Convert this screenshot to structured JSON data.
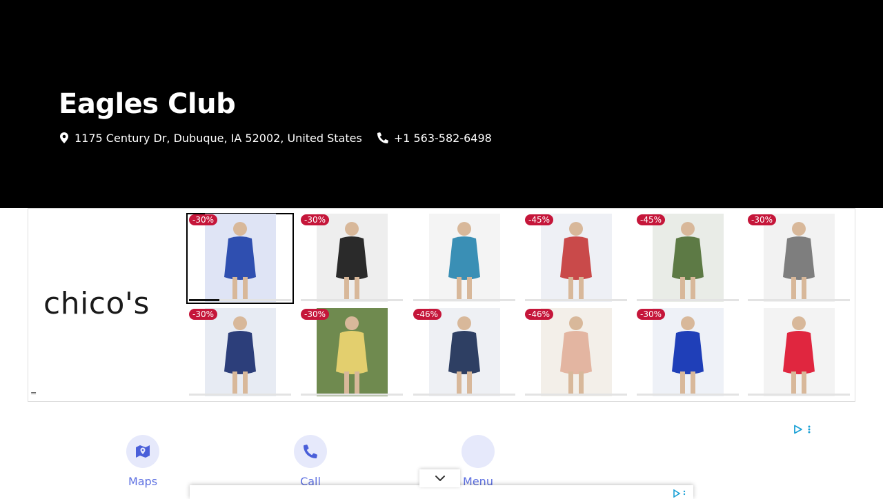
{
  "hero": {
    "title": "Eagles Club",
    "address": "1175 Century Dr, Dubuque, IA 52002, United States",
    "phone": "+1 563-582-6498"
  },
  "ad": {
    "brand": "chico's",
    "products": [
      {
        "discount": "-30%",
        "image": "woman in blue floral knee-length dress",
        "selected": true,
        "progress": 0.3
      },
      {
        "discount": "-30%",
        "image": "woman in black and white zebra print cardigan"
      },
      {
        "discount": "",
        "image": "blue and turquoise jeweled shell brooch"
      },
      {
        "discount": "-45%",
        "image": "woman in white floral print pants"
      },
      {
        "discount": "-45%",
        "image": "woman in green floral maxi shirt dress"
      },
      {
        "discount": "-30%",
        "image": "gray patterned cropped pants"
      },
      {
        "discount": "-30%",
        "image": "woman in navy printed blouse"
      },
      {
        "discount": "-30%",
        "image": "woman in yellow dress by vintage car"
      },
      {
        "discount": "-46%",
        "image": "woman in long denim jacket"
      },
      {
        "discount": "-46%",
        "image": "woman in blush floral print dress"
      },
      {
        "discount": "-30%",
        "image": "woman in royal blue lace shirt"
      },
      {
        "discount": "",
        "image": "woman in red sleeveless midi dress"
      }
    ]
  },
  "quick_actions": [
    {
      "label": "Maps",
      "icon": "map-icon"
    },
    {
      "label": "Call",
      "icon": "phone-icon"
    },
    {
      "label": "Menu",
      "icon": "menu-icon"
    }
  ],
  "colors": {
    "hero_bg": "#000000",
    "badge": "#c5163a",
    "accent": "#5b6ee1",
    "circle_bg": "#e6e9fb"
  }
}
